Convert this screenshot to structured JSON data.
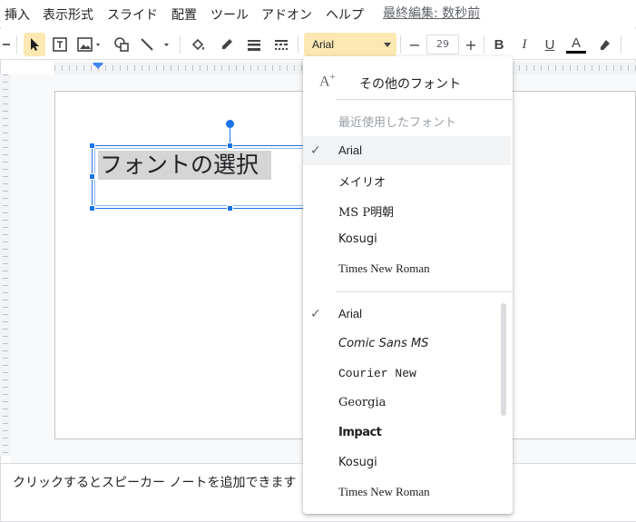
{
  "menubar": {
    "items": [
      "挿入",
      "表示形式",
      "スライド",
      "配置",
      "ツール",
      "アドオン",
      "ヘルプ"
    ],
    "last_edit": "最終編集: 数秒前"
  },
  "toolbar": {
    "font_name": "Arial",
    "font_size": "29",
    "decrease": "−",
    "increase": "+",
    "bold": "B",
    "italic": "I",
    "underline": "U",
    "text_color": "A"
  },
  "slide": {
    "text": "フォントの選択"
  },
  "notes": {
    "placeholder": "クリックするとスピーカー ノートを追加できます"
  },
  "font_menu": {
    "more_fonts": "その他のフォント",
    "recent_header": "最近使用したフォント",
    "recent": [
      {
        "name": "Arial",
        "checked": true
      },
      {
        "name": "メイリオ",
        "checked": false
      },
      {
        "name": "MS P明朝",
        "checked": false
      },
      {
        "name": "Kosugi",
        "checked": false
      },
      {
        "name": "Times New Roman",
        "checked": false
      }
    ],
    "all": [
      {
        "name": "Arial",
        "checked": true
      },
      {
        "name": "Comic Sans MS",
        "checked": false
      },
      {
        "name": "Courier New",
        "checked": false
      },
      {
        "name": "Georgia",
        "checked": false
      },
      {
        "name": "Impact",
        "checked": false
      },
      {
        "name": "Kosugi",
        "checked": false
      },
      {
        "name": "Times New Roman",
        "checked": false
      }
    ],
    "check_mark": "✓"
  },
  "colors": {
    "accent": "#1a73e8",
    "highlight": "#fce8b2",
    "text_color_bar": "#000000"
  }
}
